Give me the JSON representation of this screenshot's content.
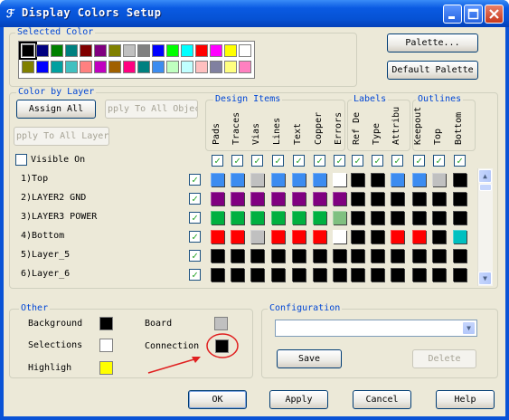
{
  "window": {
    "title": "Display Colors Setup"
  },
  "selected_color": {
    "legend": "Selected Color",
    "palette_row1": [
      "#000000",
      "#000080",
      "#008000",
      "#008080",
      "#800000",
      "#800080",
      "#808000",
      "#c0c0c0",
      "#808080",
      "#0000ff",
      "#00ff00",
      "#00ffff",
      "#ff0000",
      "#ff00ff",
      "#ffff00",
      "#ffffff"
    ],
    "palette_row2": [
      "#808000",
      "#0000ff",
      "#00a0a0",
      "#40c0c0",
      "#ff8080",
      "#c000c0",
      "#a06000",
      "#ff0080",
      "#008080",
      "#3c8cf0",
      "#c0ffc0",
      "#c0ffff",
      "#ffc0c0",
      "#8080a0",
      "#ffff80",
      "#ff80c0"
    ]
  },
  "buttons": {
    "palette": "Palette...",
    "default_palette": "Default Palette",
    "assign_all": "Assign All",
    "apply_to_all_objects": "pply To All Objec",
    "apply_to_all_layers": "pply To All Layer",
    "save": "Save",
    "delete": "Delete",
    "ok": "OK",
    "apply": "Apply",
    "cancel": "Cancel",
    "help": "Help"
  },
  "color_by_layer": {
    "legend": "Color by Layer",
    "design_items_legend": "Design Items",
    "labels_legend": "Labels",
    "outlines_legend": "Outlines",
    "visible_only": "Visible On",
    "columns": [
      "Pads",
      "Traces",
      "Vias",
      "Lines",
      "Text",
      "Copper",
      "Errors",
      "Ref De",
      "Type",
      "Attribu",
      "Keepout",
      "Top",
      "Bottom"
    ],
    "layers": [
      {
        "name": "1)Top",
        "colors": [
          "#3c8cf0",
          "#3c8cf0",
          "#c0c0c0",
          "#3c8cf0",
          "#3c8cf0",
          "#3c8cf0",
          "#ffffff",
          "#000000",
          "#000000",
          "#3c8cf0",
          "#3c8cf0",
          "#c0c0c0",
          "#000000"
        ]
      },
      {
        "name": "2)LAYER2 GND",
        "colors": [
          "#800080",
          "#800080",
          "#800080",
          "#800080",
          "#800080",
          "#800080",
          "#800080",
          "#000000",
          "#000000",
          "#000000",
          "#000000",
          "#000000",
          "#000000"
        ]
      },
      {
        "name": "3)LAYER3 POWER",
        "colors": [
          "#00b040",
          "#00b040",
          "#00b040",
          "#00b040",
          "#00b040",
          "#00b040",
          "#80c080",
          "#000000",
          "#000000",
          "#000000",
          "#000000",
          "#000000",
          "#000000"
        ]
      },
      {
        "name": "4)Bottom",
        "colors": [
          "#ff0000",
          "#ff0000",
          "#c0c0c0",
          "#ff0000",
          "#ff0000",
          "#ff0000",
          "#ffffff",
          "#000000",
          "#000000",
          "#ff0000",
          "#ff0000",
          "#000000",
          "#00c0c0"
        ]
      },
      {
        "name": "5)Layer_5",
        "colors": [
          "#000000",
          "#000000",
          "#000000",
          "#000000",
          "#000000",
          "#000000",
          "#000000",
          "#000000",
          "#000000",
          "#000000",
          "#000000",
          "#000000",
          "#000000"
        ]
      },
      {
        "name": "6)Layer_6",
        "colors": [
          "#000000",
          "#000000",
          "#000000",
          "#000000",
          "#000000",
          "#000000",
          "#000000",
          "#000000",
          "#000000",
          "#000000",
          "#000000",
          "#000000",
          "#000000"
        ]
      }
    ]
  },
  "other": {
    "legend": "Other",
    "background_label": "Background",
    "background_color": "#000000",
    "selections_label": "Selections",
    "selections_color": "#ffffff",
    "highlight_label": "Highligh",
    "highlight_color": "#ffff00",
    "board_label": "Board",
    "board_color": "#c0c0c0",
    "connection_label": "Connection",
    "connection_color": "#000000"
  },
  "configuration": {
    "legend": "Configuration",
    "selected": ""
  },
  "annotation": {
    "arrow_color": "#e02020"
  }
}
